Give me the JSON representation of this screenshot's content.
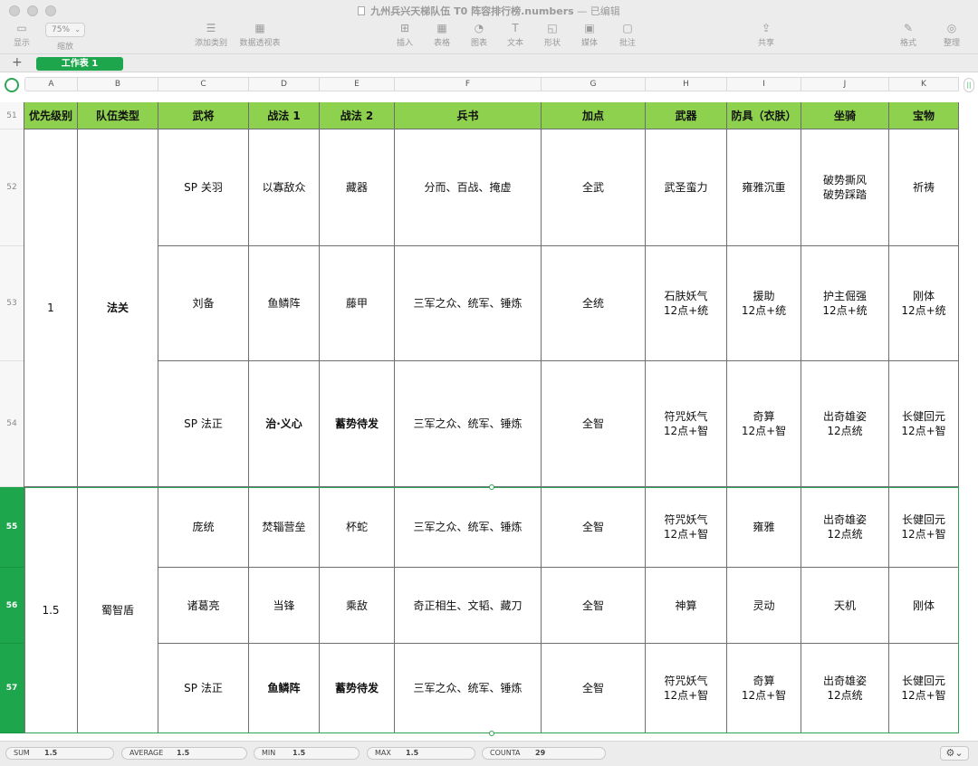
{
  "window": {
    "title": "九州兵兴天梯队伍 T0 阵容排行榜.numbers",
    "edited": "— 已编辑"
  },
  "toolbar": {
    "view": "显示",
    "zoom_value": "75%",
    "zoom_label": "缩放",
    "add_category": "添加类别",
    "pivot_table": "数据透视表",
    "insert": "插入",
    "table": "表格",
    "chart": "图表",
    "text": "文本",
    "shape": "形状",
    "media": "媒体",
    "comment": "批注",
    "share": "共享",
    "format": "格式",
    "organize": "整理"
  },
  "sheet_tabs": {
    "add": "+",
    "active": "工作表 1"
  },
  "columns": [
    "A",
    "B",
    "C",
    "D",
    "E",
    "F",
    "G",
    "H",
    "I",
    "J",
    "K"
  ],
  "rows": [
    {
      "num": "51",
      "selected": false
    },
    {
      "num": "52",
      "selected": false
    },
    {
      "num": "53",
      "selected": false
    },
    {
      "num": "54",
      "selected": false
    },
    {
      "num": "55",
      "selected": true
    },
    {
      "num": "56",
      "selected": true
    },
    {
      "num": "57",
      "selected": true
    }
  ],
  "table": {
    "headers": [
      "优先级别",
      "队伍类型",
      "武将",
      "战法 1",
      "战法 2",
      "兵书",
      "加点",
      "武器",
      "防具（衣肤）",
      "坐骑",
      "宝物"
    ],
    "groups": [
      {
        "priority": "1",
        "team_type": "法关"
      },
      {
        "priority": "1.5",
        "team_type": "蜀智盾"
      }
    ],
    "body": [
      [
        "SP 关羽",
        "以寡敌众",
        "藏器",
        "分而、百战、掩虚",
        "全武",
        "武圣蛮力",
        "雍雅沉重",
        "破势撕风\n破势踩踏",
        "祈祷"
      ],
      [
        "刘备",
        "鱼鳞阵",
        "藤甲",
        "三军之众、统军、锤炼",
        "全统",
        "石肤妖气\n12点+统",
        "援助\n12点+统",
        "护主倔强\n12点+统",
        "刚体\n12点+统"
      ],
      [
        "SP 法正",
        "治·义心",
        "蓄势待发",
        "三军之众、统军、锤炼",
        "全智",
        "符咒妖气\n12点+智",
        "奇算\n12点+智",
        "出奇雄姿\n12点统",
        "长健回元\n12点+智"
      ],
      [
        "庞统",
        "焚辎营垒",
        "杯蛇",
        "三军之众、统军、锤炼",
        "全智",
        "符咒妖气\n12点+智",
        "雍雅",
        "出奇雄姿\n12点统",
        "长健回元\n12点+智"
      ],
      [
        "诸葛亮",
        "当锋",
        "乘敌",
        "奇正相生、文韬、藏刀",
        "全智",
        "神算",
        "灵动",
        "天机",
        "刚体"
      ],
      [
        "SP 法正",
        "鱼鳞阵",
        "蓄势待发",
        "三军之众、统军、锤炼",
        "全智",
        "符咒妖气\n12点+智",
        "奇算\n12点+智",
        "出奇雄姿\n12点统",
        "长健回元\n12点+智"
      ]
    ]
  },
  "status": {
    "sum_label": "SUM",
    "sum": "1.5",
    "avg_label": "AVERAGE",
    "avg": "1.5",
    "min_label": "MIN",
    "min": "1.5",
    "max_label": "MAX",
    "max": "1.5",
    "counta_label": "COUNTA",
    "counta": "29"
  },
  "colors": {
    "header_green": "#8ed14e",
    "accent_green": "#1ea64c"
  }
}
